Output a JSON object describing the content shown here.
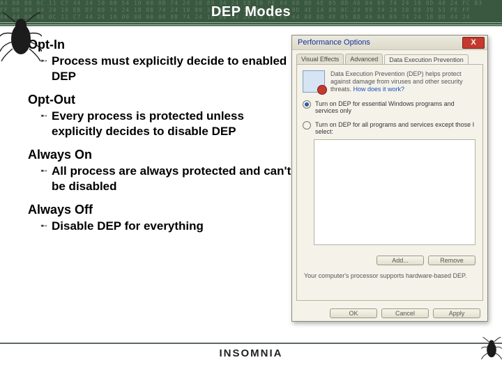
{
  "title": "DEP Modes",
  "brand": "INSOMNIA",
  "hex_pattern": "A4 08 88 0C 11 C7 44 24 10 00 54 10 00 8B 74 24 10 89 34 24 E8 10 FE 64 08 8D 4E 05 8D 46 04 89 74 24 18 8D 48 24 FC B3\nFF D0 89 44 24 10 EB D7 89 74 24 18 8B 74 24 10 89 34 24 E8 1C FF FF FF 8D 4E 14 89 0C 24 89 74 24 18 E8 39 53 FE FF\n0A 44 08 88 0C 11 C7 44 24 10 00 00 00 00 8B 74 24 10 89 34 24 E8 10 FE 64 08 8D 4E 05 8D 46 04 89 74 24 18 8D 44 24",
  "modes": [
    {
      "name": "Opt-In",
      "bullet": "Process must explicitly decide to enabled DEP"
    },
    {
      "name": "Opt-Out",
      "bullet": "Every process is protected unless explicitly decides to disable DEP"
    },
    {
      "name": "Always On",
      "bullet": "All process are always protected and can't be disabled"
    },
    {
      "name": "Always Off",
      "bullet": "Disable DEP for everything"
    }
  ],
  "dialog": {
    "title": "Performance Options",
    "close": "X",
    "tabs": [
      "Visual Effects",
      "Advanced",
      "Data Execution Prevention"
    ],
    "active_tab": 2,
    "blurb": "Data Execution Prevention (DEP) helps protect against damage from viruses and other security threats.",
    "blurb_link": "How does it work?",
    "opt1": "Turn on DEP for essential Windows programs and services only",
    "opt2": "Turn on DEP for all programs and services except those I select:",
    "btn_add": "Add...",
    "btn_remove": "Remove",
    "hw": "Your computer's processor supports hardware-based DEP.",
    "ok": "OK",
    "cancel": "Cancel",
    "apply": "Apply"
  }
}
